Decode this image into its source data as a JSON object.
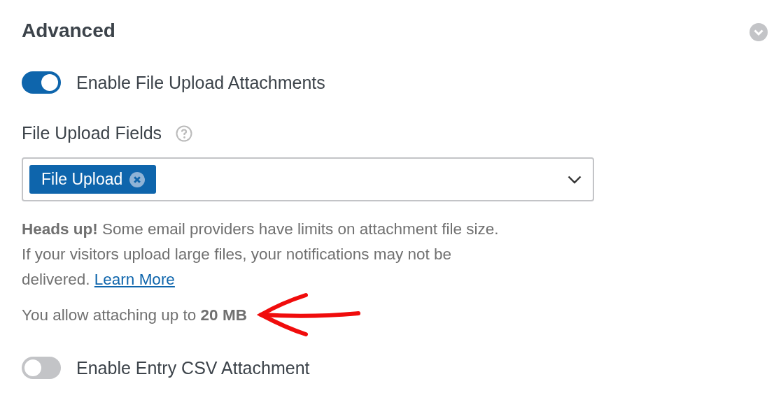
{
  "section": {
    "title": "Advanced",
    "collapse_expanded": true
  },
  "toggles_top": [
    {
      "label": "Enable File Upload Attachments",
      "on": true
    }
  ],
  "upload_fields": {
    "label": "File Upload Fields",
    "help": true,
    "tags": [
      {
        "label": "File Upload"
      }
    ]
  },
  "notice": {
    "text": "**Heads up!** Some email providers have limits on attachment file size. If your visitors upload large files, your notifications may not be delivered.",
    "link": "Learn More"
  },
  "limit": {
    "text": "You allow attaching up to **20 MB**",
    "annotation": {
      "kind": "arrow"
    }
  },
  "toggles_bottom": [
    {
      "label": "Enable Entry CSV Attachment",
      "on": false
    }
  ]
}
